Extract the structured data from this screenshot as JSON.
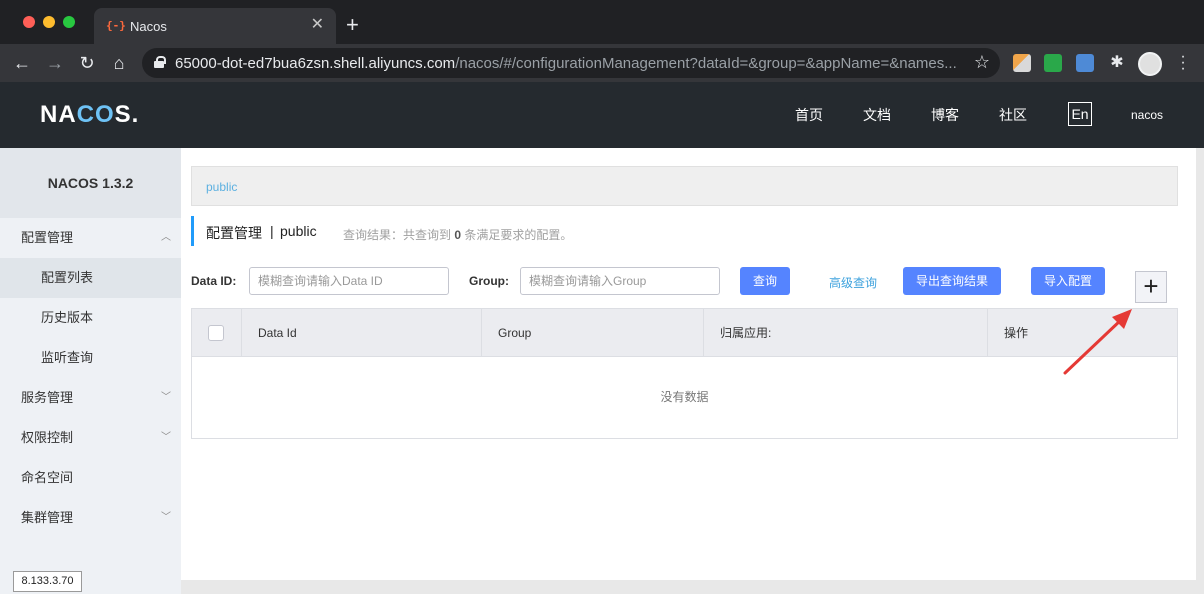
{
  "browser": {
    "tab_title": "Nacos",
    "tab_favicon": "{-}",
    "tab_close": "✕",
    "new_tab": "+",
    "url_host": "65000-dot-ed7bua6zsn.shell.aliyuncs.com",
    "url_path": "/nacos/#/configurationManagement?dataId=&group=&appName=&names...",
    "icons": [
      "back-icon",
      "forward-icon",
      "reload-icon",
      "home-icon",
      "lock-icon",
      "star-icon",
      "extensions-icon",
      "profile-avatar",
      "menu-icon"
    ]
  },
  "header": {
    "logo_left": "NA",
    "logo_accent": "CO",
    "logo_right": "S.",
    "nav": [
      "首页",
      "文档",
      "博客",
      "社区"
    ],
    "lang": "En",
    "user": "nacos"
  },
  "sidebar": {
    "version": "NACOS 1.3.2",
    "items": [
      {
        "label": "配置管理",
        "expanded": true
      },
      {
        "label": "配置列表",
        "sub": true,
        "active": true
      },
      {
        "label": "历史版本",
        "sub": true
      },
      {
        "label": "监听查询",
        "sub": true
      },
      {
        "label": "服务管理"
      },
      {
        "label": "权限控制"
      },
      {
        "label": "命名空间"
      },
      {
        "label": "集群管理"
      }
    ],
    "ip": "8.133.3.70"
  },
  "main": {
    "namespace_link": "public",
    "title": "配置管理",
    "title_sep": "|",
    "title_namespace": "public",
    "result_prefix": "查询结果：共查询到",
    "result_count": "0",
    "result_suffix": "条满足要求的配置。",
    "filter": {
      "dataid_label": "Data ID:",
      "dataid_placeholder": "模糊查询请输入Data ID",
      "group_label": "Group:",
      "group_placeholder": "模糊查询请输入Group",
      "search_button": "查询",
      "advanced_link": "高级查询",
      "export_button": "导出查询结果",
      "import_button": "导入配置",
      "add_button": "+"
    },
    "table": {
      "columns": [
        "Data Id",
        "Group",
        "归属应用:",
        "操作"
      ],
      "empty_text": "没有数据"
    }
  },
  "colors": {
    "primary": "#5584ff",
    "header_bg": "#252a2f",
    "accent_arrow": "#e53935"
  }
}
